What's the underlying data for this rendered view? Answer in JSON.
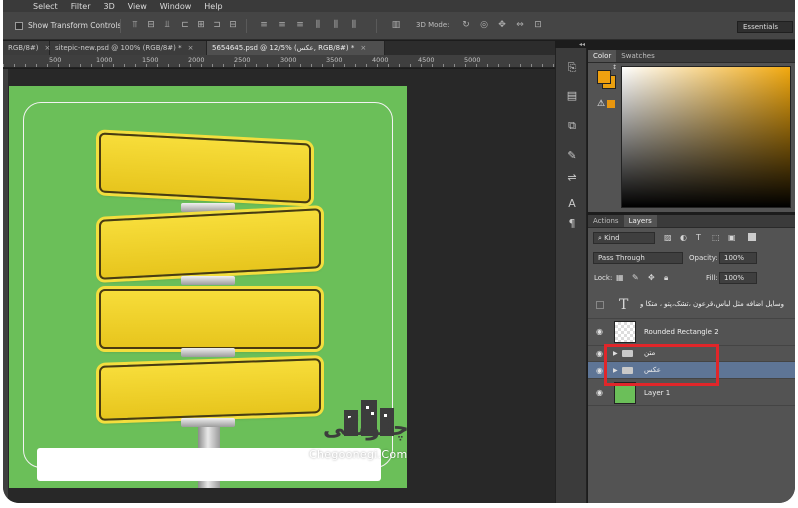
{
  "menu": [
    "Select",
    "Filter",
    "3D",
    "View",
    "Window",
    "Help"
  ],
  "options": {
    "show_transform_controls": "Show Transform Controls",
    "mode_3d": "3D Mode:",
    "workspace": "Essentials"
  },
  "tabs": [
    {
      "label": "RGB/8#)",
      "close": "×"
    },
    {
      "label": "sitepic-new.psd @ 100% (RGB/8#) *",
      "close": "×"
    },
    {
      "label": "5654645.psd @ 12/5% (عکس, RGB/8#) *",
      "close": "×"
    }
  ],
  "ruler": [
    "500",
    "1000",
    "1500",
    "2000",
    "2500",
    "3000",
    "3500",
    "4000",
    "4500",
    "5000"
  ],
  "watermark": {
    "farsi": "چگونگی",
    "latin": "Chegoonegi.Com"
  },
  "panels": {
    "color_tabs": [
      "Color",
      "Swatches"
    ],
    "layers_tabs": [
      "Actions",
      "Layers"
    ],
    "collapse": "◂◂"
  },
  "layers_panel": {
    "filter_kind": "Kind",
    "blend_mode": "Pass Through",
    "opacity_label": "Opacity:",
    "opacity_value": "100%",
    "lock_label": "Lock:",
    "fill_label": "Fill:",
    "fill_value": "100%",
    "layers": [
      {
        "name": "وسایل اضافه مثل لباس،قرعون ،تشک،پتو ، متکا و",
        "type": "text"
      },
      {
        "name": "Rounded Rectangle 2",
        "type": "shape"
      },
      {
        "name": "متن",
        "type": "group"
      },
      {
        "name": "عکس",
        "type": "group",
        "selected": true
      },
      {
        "name": "Layer 1",
        "type": "fill"
      }
    ]
  },
  "colors": {
    "foreground": "#f0a10f",
    "canvas_green": "#6bbf59",
    "selection_blue": "#5e7596",
    "highlight_red": "#e0262a"
  }
}
